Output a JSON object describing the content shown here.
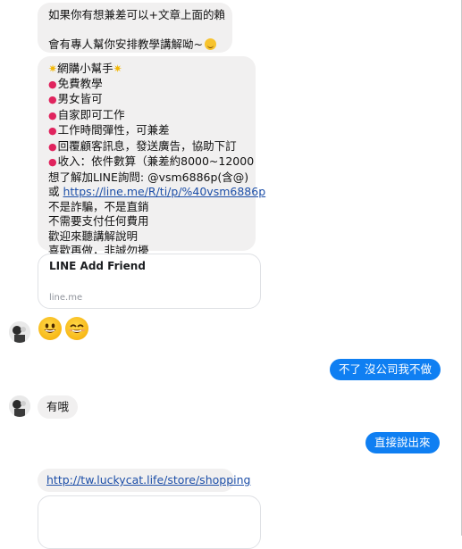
{
  "messages": {
    "m1": {
      "line1": "如果你有想兼差可以+文章上面的賴",
      "line2": "會有專人幫你安排教學講解呦~"
    },
    "m2": {
      "title": "網購小幫手",
      "items": [
        "免費教學",
        "男女皆可",
        "自家即可工作",
        "工作時間彈性，可兼差",
        "回覆顧客訊息，發送廣告，協助下訂",
        "收入：依件數算（兼差約8000~12000"
      ],
      "contact_prefix": "想了解加LINE詢問: ",
      "contact_id": "@vsm6886p(含@)",
      "or_label": "或 ",
      "line_url": "https://line.me/R/ti/p/%40vsm6886p",
      "notes": [
        "不是詐騙，不是直銷",
        "不需要支付任何費用",
        "歡迎來聽講解說明",
        "喜歡再做，非誠勿擾"
      ]
    },
    "card1": {
      "title": "LINE Add Friend",
      "domain": "line.me"
    },
    "m3": {
      "text": "有哦"
    },
    "m4": {
      "url": "http://tw.luckycat.life/store/shopping"
    },
    "reply1": {
      "text": "不了 沒公司我不做"
    },
    "reply2": {
      "text": "直接說出來"
    }
  },
  "icons": {
    "pin": "round-pushpin-icon",
    "sparkle": "sparkle-icon",
    "wink": "winking-smiley-icon",
    "grin": "grinning-face-icon",
    "smile": "smiling-face-icon"
  },
  "colors": {
    "incoming_bubble": "#f1f0f0",
    "outgoing_bubble": "#0f7ff2",
    "link": "#1d4fa8",
    "pin": "#e0245e"
  }
}
